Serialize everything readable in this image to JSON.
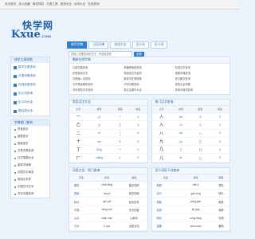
{
  "topbar": {
    "links": [
      "设为首页",
      "加入收藏",
      "网站导航",
      "汉语工具",
      "成语大全",
      "诗词大全",
      "在线查询"
    ]
  },
  "logo": {
    "cn": "快学网",
    "en": "Kxue",
    "domain": ".com"
  },
  "nav": {
    "tabs": [
      "新华字典",
      "汉语词典",
      "成语大全",
      "近义词",
      "反义词"
    ]
  },
  "search": {
    "placeholder": "请输入您要查询的汉字、拼音或部首",
    "button": "查询"
  },
  "hot": {
    "label": "热门：",
    "items": [
      "字典",
      "词典",
      "成语",
      "组词",
      "造句",
      "拼音"
    ]
  },
  "sidebar": {
    "tools_title": "快学工具导航",
    "tools": [
      "新华字典查询",
      "汉语词典查询",
      "在线成语查询",
      "近义词查询",
      "反义词大全",
      "歇后语大全"
    ],
    "hot_title": "字典热门查询",
    "hot": [
      "拼音查字",
      "部首查字",
      "笔画查字",
      "五笔字根查询",
      "汉字笔顺大全",
      "繁体字转换",
      "中国汉字演变",
      "常用汉字表",
      "中国古代汉字",
      "书法字典查询"
    ]
  },
  "main": {
    "recommend_title": "最新在线字典",
    "recommend": [
      "汉语字典查询",
      "带偏旁部首查询",
      "在线汉字查询",
      "拼音查询汉字",
      "笔画查汉字结构",
      "康熙字典查询",
      "五笔输入法查询",
      "繁体字在线转换",
      "说文解字查询",
      "汉字笔画顺序查询",
      "字词对照查询",
      "成语大全词典",
      "书写规范汉字查询",
      "常见生僻字大全",
      "多音字组词查询"
    ],
    "left_title": "常用汉字大全",
    "right_title": "热门汉字查询",
    "table_headers": [
      "汉字",
      "拼音",
      "部首",
      "笔画"
    ],
    "left_rows": [
      [
        "一",
        "yī",
        "一",
        "1"
      ],
      [
        "乙",
        "yǐ",
        "乙",
        "1"
      ],
      [
        "二",
        "èr",
        "二",
        "2"
      ],
      [
        "十",
        "shí",
        "十",
        "2"
      ],
      [
        "丁",
        "dīng",
        "一",
        "2"
      ],
      [
        "厂",
        "chǎng",
        "厂",
        "2"
      ]
    ],
    "right_rows": [
      [
        "人",
        "rén",
        "人",
        "2"
      ],
      [
        "入",
        "rù",
        "入",
        "2"
      ],
      [
        "八",
        "bā",
        "八",
        "2"
      ],
      [
        "九",
        "jiǔ",
        "乙",
        "2"
      ],
      [
        "几",
        "jǐ",
        "几",
        "2"
      ],
      [
        "儿",
        "ér",
        "儿",
        "2"
      ]
    ],
    "words_left_title": "词语大全：热门查询",
    "words_right_title": "近义词反义词查询",
    "words_headers": [
      "词语",
      "拼音",
      "解释"
    ],
    "words_left": [
      [
        "春风",
        "chūn fēng",
        "春天的风"
      ],
      [
        "夏雨",
        "xià yǔ",
        "夏天的雨"
      ],
      [
        "秋月",
        "qiū yuè",
        "秋天的月"
      ],
      [
        "冬雪",
        "dōng xuě",
        "冬天的雪"
      ],
      [
        "山水",
        "shān shuǐ",
        "山和水"
      ],
      [
        "日月",
        "rì yuè",
        "太阳月亮"
      ]
    ],
    "words_right": [
      [
        "美丽",
        "měi lì",
        "漂亮"
      ],
      [
        "高兴",
        "gāo xìng",
        "快乐"
      ],
      [
        "勇敢",
        "yǒng gǎn",
        "英勇"
      ],
      [
        "安静",
        "ān jìng",
        "寂静"
      ],
      [
        "明亮",
        "míng liàng",
        "光明"
      ],
      [
        "温暖",
        "wēn nuǎn",
        "暖和"
      ]
    ]
  }
}
